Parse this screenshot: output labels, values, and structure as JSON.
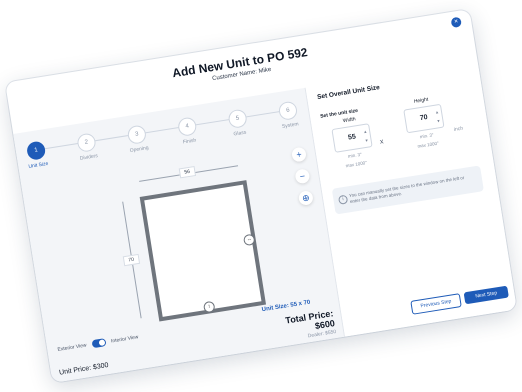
{
  "header": {
    "title": "Add New Unit to PO 592",
    "subtitle": "Customer Name: Mike"
  },
  "stepper": {
    "steps": [
      {
        "number": "1",
        "label": "Unit Size",
        "active": true
      },
      {
        "number": "2",
        "label": "Dividers",
        "active": false
      },
      {
        "number": "3",
        "label": "Opening",
        "active": false
      },
      {
        "number": "4",
        "label": "Finish",
        "active": false
      },
      {
        "number": "5",
        "label": "Glass",
        "active": false
      },
      {
        "number": "6",
        "label": "System",
        "active": false
      }
    ]
  },
  "tools": {
    "zoom_in": "+",
    "zoom_out": "−",
    "recenter": "⊕"
  },
  "drawing": {
    "width_dim": "56",
    "height_dim": "70",
    "unit_size": "Unit Size: 55 x 70"
  },
  "view_toggle": {
    "exterior": "Exterior View",
    "interior": "Interior View"
  },
  "pricing": {
    "total_price": "Total Price:  $600",
    "dealer": "Dealer:  $550",
    "unit_price": "Unit Price:  $300"
  },
  "overall_size": {
    "title": "Set Overall Unit Size",
    "section_label": "Set the unit size",
    "width": {
      "label": "Width",
      "value": "55",
      "min": "min. 3\"",
      "max": "max 1000\""
    },
    "height": {
      "label": "Height",
      "value": "70",
      "min": "min. 3\"",
      "max": "max 1000\""
    },
    "times": "x",
    "unit": "inch",
    "info": "You can manually set the sizes to the window on the left or enter the data from above."
  },
  "actions": {
    "previous": "Previous Step",
    "next": "Next Step"
  },
  "colors": {
    "accent": "#1e5bb8",
    "frame": "#6f757d",
    "panel_bg": "#f3f5f8"
  }
}
